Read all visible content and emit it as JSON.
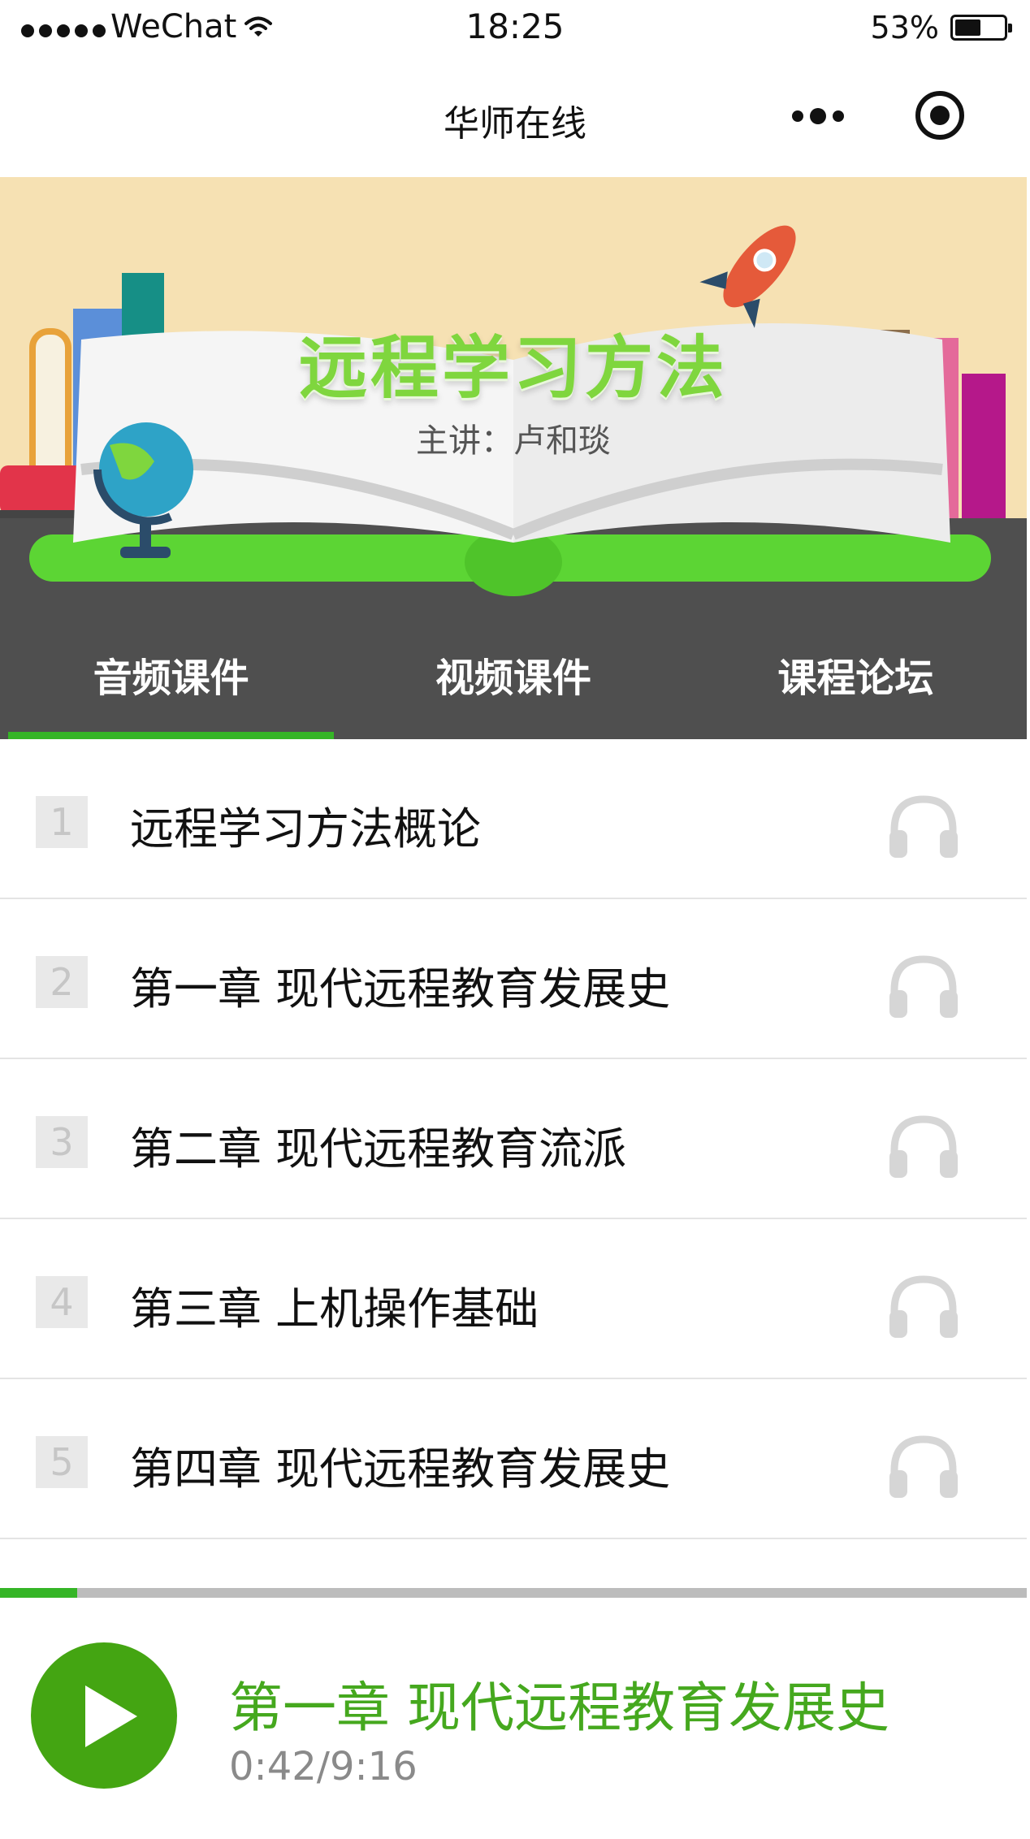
{
  "status_bar": {
    "carrier": "WeChat",
    "time": "18:25",
    "battery_percent": "53%",
    "battery_level": 0.53
  },
  "nav": {
    "title": "华师在线"
  },
  "banner": {
    "title": "远程学习方法",
    "subtitle": "主讲：卢和琰"
  },
  "tabs": [
    {
      "label": "音频课件",
      "active": true
    },
    {
      "label": "视频课件",
      "active": false
    },
    {
      "label": "课程论坛",
      "active": false
    }
  ],
  "lessons": [
    {
      "number": "1",
      "title": "远程学习方法概论",
      "icon": "headphones-icon"
    },
    {
      "number": "2",
      "title": "第一章 现代远程教育发展史",
      "icon": "headphones-icon"
    },
    {
      "number": "3",
      "title": "第二章 现代远程教育流派",
      "icon": "headphones-icon"
    },
    {
      "number": "4",
      "title": "第三章 上机操作基础",
      "icon": "headphones-icon"
    },
    {
      "number": "5",
      "title": "第四章 现代远程教育发展史",
      "icon": "headphones-icon"
    }
  ],
  "player": {
    "now_playing": "第一章 现代远程教育发展史",
    "time_display": "0:42/9:16",
    "progress_fraction": 0.075,
    "play_icon": "play-icon"
  },
  "colors": {
    "accent_green": "#35b526",
    "play_button": "#44a512",
    "now_playing_text": "#45a81e",
    "tab_bar_bg": "#4f4f4f",
    "banner_bg": "#f6e1b3"
  }
}
